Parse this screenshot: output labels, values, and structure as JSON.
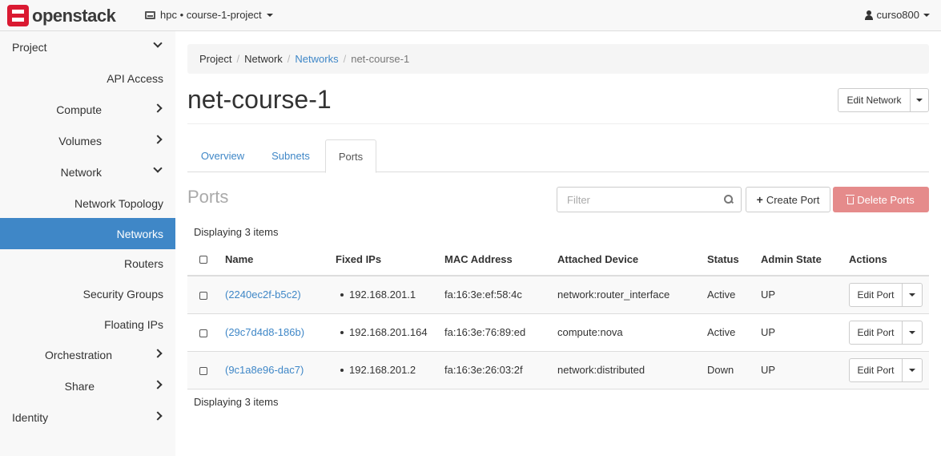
{
  "brand": {
    "name": "openstack",
    "mark_color": "#da1a32"
  },
  "topbar": {
    "project_label": "hpc • course-1-project",
    "user_label": "curso800"
  },
  "sidebar": {
    "items": [
      {
        "label": "Project",
        "chevron": "down"
      },
      {
        "label": "API Access"
      },
      {
        "label": "Compute",
        "chevron": "right"
      },
      {
        "label": "Volumes",
        "chevron": "right"
      },
      {
        "label": "Network",
        "chevron": "down"
      },
      {
        "label": "Network Topology"
      },
      {
        "label": "Networks",
        "active": true
      },
      {
        "label": "Routers"
      },
      {
        "label": "Security Groups"
      },
      {
        "label": "Floating IPs"
      },
      {
        "label": "Orchestration",
        "chevron": "right"
      },
      {
        "label": "Share",
        "chevron": "right"
      },
      {
        "label": "Identity",
        "chevron": "right"
      }
    ],
    "active_color": "#3f87c7"
  },
  "breadcrumb": [
    "Project",
    "Network",
    "Networks",
    "net-course-1"
  ],
  "page": {
    "title": "net-course-1",
    "edit_button": "Edit Network"
  },
  "tabs": [
    "Overview",
    "Subnets",
    "Ports"
  ],
  "ports": {
    "title": "Ports",
    "filter_placeholder": "Filter",
    "create_label": "Create Port",
    "delete_label": "Delete Ports",
    "count_top": "Displaying 3 items",
    "count_bottom": "Displaying 3 items",
    "columns": [
      "Name",
      "Fixed IPs",
      "MAC Address",
      "Attached Device",
      "Status",
      "Admin State",
      "Actions"
    ],
    "rows": [
      {
        "name": "(2240ec2f-b5c2)",
        "ip": "192.168.201.1",
        "mac": "fa:16:3e:ef:58:4c",
        "device": "network:router_interface",
        "status": "Active",
        "admin": "UP",
        "action": "Edit Port"
      },
      {
        "name": "(29c7d4d8-186b)",
        "ip": "192.168.201.164",
        "mac": "fa:16:3e:76:89:ed",
        "device": "compute:nova",
        "status": "Active",
        "admin": "UP",
        "action": "Edit Port"
      },
      {
        "name": "(9c1a8e96-dac7)",
        "ip": "192.168.201.2",
        "mac": "fa:16:3e:26:03:2f",
        "device": "network:distributed",
        "status": "Down",
        "admin": "UP",
        "action": "Edit Port"
      }
    ]
  }
}
